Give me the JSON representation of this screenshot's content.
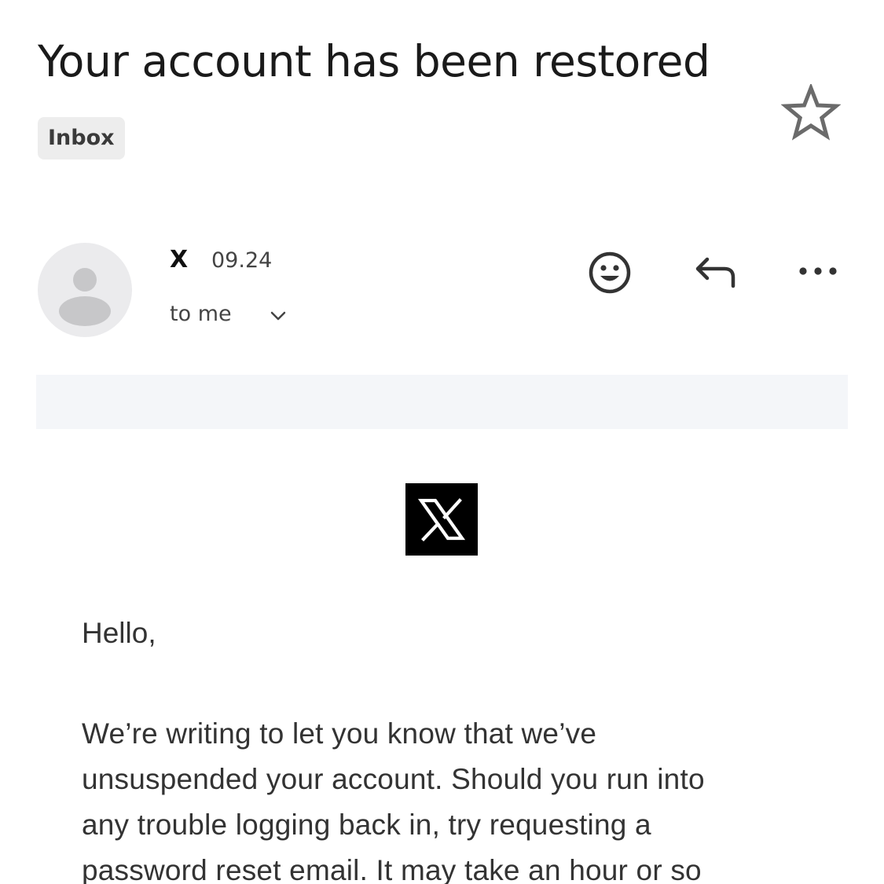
{
  "email": {
    "subject": "Your account has been restored",
    "label": "Inbox",
    "sender_name": "X",
    "time": "09.24",
    "recipient": "to me",
    "greeting": "Hello,",
    "body_lines": [
      "We’re writing to let you know that we’ve",
      "unsuspended your account. Should you run into",
      "any trouble logging back in, try requesting a",
      "password reset email. It may take an hour or so"
    ]
  },
  "icons": {
    "star": "star-outline-icon",
    "avatar": "default-avatar-icon",
    "recipient_details": "chevron-down-icon",
    "react": "emoji-smile-icon",
    "reply": "reply-arrow-icon",
    "more": "more-horizontal-icon",
    "brand_logo": "x-logo-icon"
  },
  "colors": {
    "label_chip_bg": "#ededed",
    "banner_bg": "#f4f6f9",
    "avatar_bg": "#ebebed",
    "logo_bg": "#000000"
  }
}
